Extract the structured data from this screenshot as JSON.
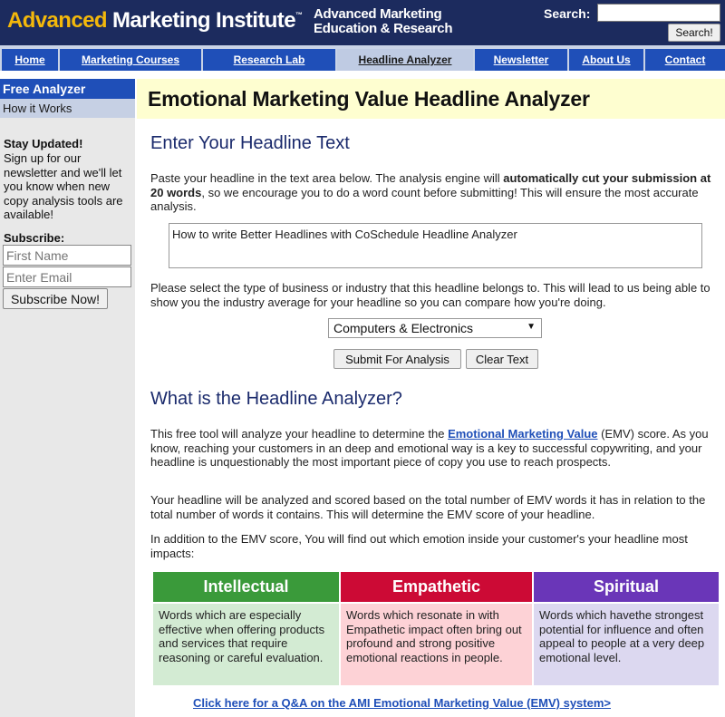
{
  "header": {
    "logo_part1": "Advanced",
    "logo_part2": "Marketing Institute",
    "logo_tm": "™",
    "tagline_line1": "Advanced Marketing",
    "tagline_line2": "Education & Research",
    "search_label": "Search:",
    "search_value": "",
    "search_button": "Search!",
    "bg_color": "#1c2b5e",
    "accent_color": "#f3b80b"
  },
  "nav": {
    "items": [
      {
        "label": "Home",
        "active": false
      },
      {
        "label": "Marketing Courses",
        "active": false
      },
      {
        "label": "Research Lab",
        "active": false
      },
      {
        "label": "Headline Analyzer",
        "active": true
      },
      {
        "label": "Newsletter",
        "active": false
      },
      {
        "label": "About Us",
        "active": false
      },
      {
        "label": "Contact",
        "active": false
      }
    ],
    "color": "#1f4fb8"
  },
  "sidebar": {
    "free_analyzer": "Free Analyzer",
    "how_it_works": "How it Works",
    "stay_updated_title": "Stay Updated!",
    "stay_updated_text": "Sign up for our newsletter and we'll let you know when new copy analysis tools are available!",
    "subscribe_title": "Subscribe:",
    "first_name_placeholder": "First Name",
    "email_placeholder": "Enter Email",
    "subscribe_button": "Subscribe Now!"
  },
  "main": {
    "title": "Emotional Marketing Value Headline Analyzer",
    "enter_heading": "Enter Your Headline Text",
    "intro_part1": "Paste your headline in the text area below. The analysis engine will ",
    "intro_bold": "automatically cut your submission at 20 words",
    "intro_part2": ", so we encourage you to do a word count before submitting! This will ensure the most accurate analysis.",
    "headline_value": "How to write Better Headlines with CoSchedule Headline Analyzer",
    "industry_prompt": "Please select the type of business or industry that this headline belongs to. This will lead to us being able to show you the industry average for your headline so you can compare how you're doing.",
    "industry_selected": "Computers & Electronics",
    "submit_button": "Submit For Analysis",
    "clear_button": "Clear Text",
    "what_heading": "What is the Headline Analyzer?",
    "what_p1_part1": "This free tool will analyze your headline to determine the ",
    "what_p1_link": "Emotional Marketing Value",
    "what_p1_part2": " (EMV) score. As you know, reaching your customers in an deep and emotional way is a key to successful copywriting, and your headline is unquestionably the most important piece of copy you use to reach prospects.",
    "what_p2": "Your headline will be analyzed and scored based on the total number of EMV words it has in relation to the total number of words it contains. This will determine the EMV score of your headline.",
    "what_p3": "In addition to the EMV score, You will find out which emotion inside your customer's your headline most impacts:",
    "qa_link": "Click here for a Q&A on the AMI Emotional Marketing Value (EMV) system>"
  },
  "emotions": [
    {
      "name": "Intellectual",
      "description": "Words which are especially effective when offering products and services that require reasoning or careful evaluation.",
      "head_color": "#3a9a3a",
      "body_color": "#d3ebd3"
    },
    {
      "name": "Empathetic",
      "description": "Words which resonate in with Empathetic impact often bring out profound and strong positive emotional reactions in people.",
      "head_color": "#cc0a35",
      "body_color": "#fdd2d6"
    },
    {
      "name": "Spiritual",
      "description": "Words which havethe strongest potential for influence and often appeal to people at a very deep emotional level.",
      "head_color": "#6a36b8",
      "body_color": "#dcd8f0"
    }
  ]
}
